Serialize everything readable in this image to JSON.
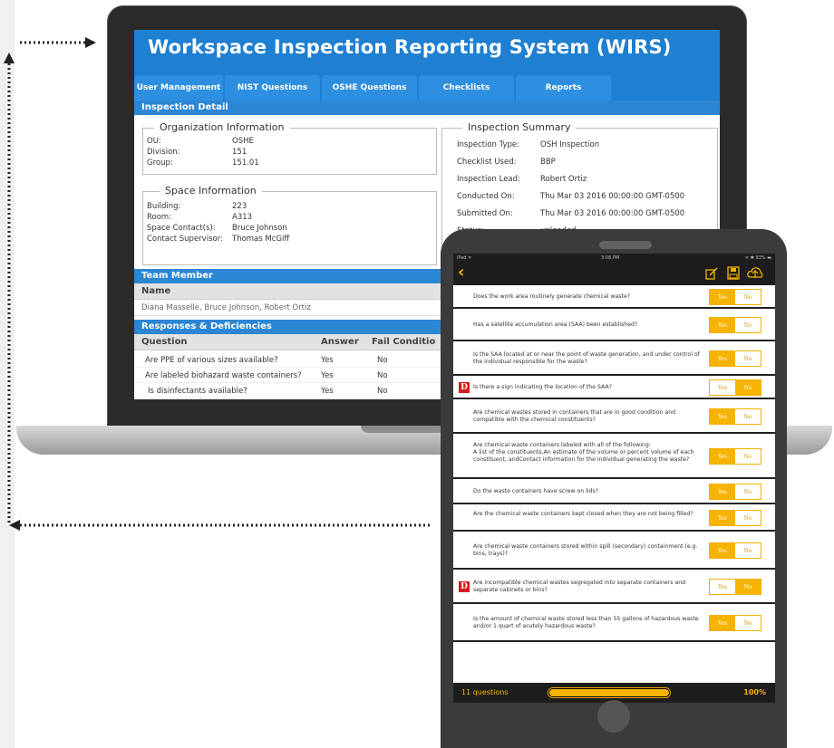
{
  "wirs": {
    "title": "Workspace Inspection Reporting System (WIRS)",
    "tabs": [
      "User Management",
      "NIST Questions",
      "OSHE Questions",
      "Checklists",
      "Reports"
    ],
    "inspection_detail_title": "Inspection Detail",
    "org_info": {
      "legend": "Organization Information",
      "rows": [
        {
          "k": "OU:",
          "v": "OSHE"
        },
        {
          "k": "Division:",
          "v": "151"
        },
        {
          "k": "Group:",
          "v": "151.01"
        }
      ]
    },
    "space_info": {
      "legend": "Space Information",
      "rows": [
        {
          "k": "Building:",
          "v": "223"
        },
        {
          "k": "Room:",
          "v": "A313"
        },
        {
          "k": "Space Contact(s):",
          "v": "Bruce Johnson"
        },
        {
          "k": "Contact Supervisor:",
          "v": "Thomas McGiff"
        }
      ]
    },
    "summary": {
      "legend": "Inspection Summary",
      "rows": [
        {
          "k": "Inspection Type:",
          "v": "OSH Inspection"
        },
        {
          "k": "Checklist Used:",
          "v": "BBP"
        },
        {
          "k": "Inspection Lead:",
          "v": "Robert Ortiz"
        },
        {
          "k": "Conducted On:",
          "v": "Thu Mar 03 2016 00:00:00 GMT-0500"
        },
        {
          "k": "Submitted On:",
          "v": "Thu Mar 03 2016 00:00:00 GMT-0500"
        },
        {
          "k": "Status:",
          "v": "uploaded"
        }
      ]
    },
    "team": {
      "title": "Team Member",
      "name_header": "Name",
      "value": "Diana Masselle, Bruce Johnson, Robert Ortiz"
    },
    "responses": {
      "title": "Responses & Deficiencies",
      "headers": {
        "question": "Question",
        "answer": "Answer",
        "fail": "Fail Conditio"
      },
      "rows": [
        {
          "q": "Are PPE of various sizes available?",
          "a": "Yes",
          "f": "No"
        },
        {
          "q": "Are labeled biohazard waste containers?",
          "a": "Yes",
          "f": "No"
        },
        {
          "q": "Is disinfectants available?",
          "a": "Yes",
          "f": "No"
        }
      ]
    }
  },
  "ipad": {
    "status": {
      "carrier": "iPad ᯤ",
      "time": "3:08 PM",
      "battery": "ᯤ ✱ 93% ▬"
    },
    "back_glyph": "‹",
    "icons": [
      "edit-icon",
      "save-icon",
      "cloud-upload-icon"
    ],
    "yes_label": "Yes",
    "no_label": "No",
    "flag_label": "D",
    "questions": [
      {
        "text": "Does the work area routinely generate chemical waste?",
        "answer": "yes",
        "flag": false
      },
      {
        "text": "Has a satellite accumulation area (SAA) been established?",
        "answer": "yes",
        "flag": false
      },
      {
        "text": "Is the SAA located at or near the point of waste generation, and under control of the individual responsible for the waste?",
        "answer": "yes",
        "flag": false
      },
      {
        "text": "Is there a sign indicating the location of the SAA?",
        "answer": "no",
        "flag": true
      },
      {
        "text": "Are chemical wastes stored in containers that are in good condition and compatible with the chemical constituents?",
        "answer": "yes",
        "flag": false
      },
      {
        "text": "Are chemical waste containers labeled with all of the following:\nA list of the constituents,An estimate of the volume or percent  volume of each constituent, andContact information for the individual generating the waste?",
        "answer": "yes",
        "flag": false
      },
      {
        "text": "Do the waste containers have screw on lids?",
        "answer": "yes",
        "flag": false
      },
      {
        "text": "Are the chemical waste containers kept closed when they are not being filled?",
        "answer": "yes",
        "flag": false
      },
      {
        "text": "Are chemical waste containers stored within spill (secondary) containment (e.g. bins, trays)?",
        "answer": "yes",
        "flag": false
      },
      {
        "text": "Are incompatible chemical wastes segregated into separate containers and separate cabinets or bins?",
        "answer": "no",
        "flag": true
      },
      {
        "text": "Is the amount of chemical waste stored less than 55 gallons of hazardous waste and/or 1 quart of acutely hazardous waste?",
        "answer": "yes",
        "flag": false
      }
    ],
    "footer": {
      "count": "11 questions",
      "percent": "100%",
      "progress": 1.0
    }
  },
  "colors": {
    "brand_blue": "#1f7fd0",
    "accent_yellow": "#f6b400",
    "flag_red": "#d71920"
  }
}
